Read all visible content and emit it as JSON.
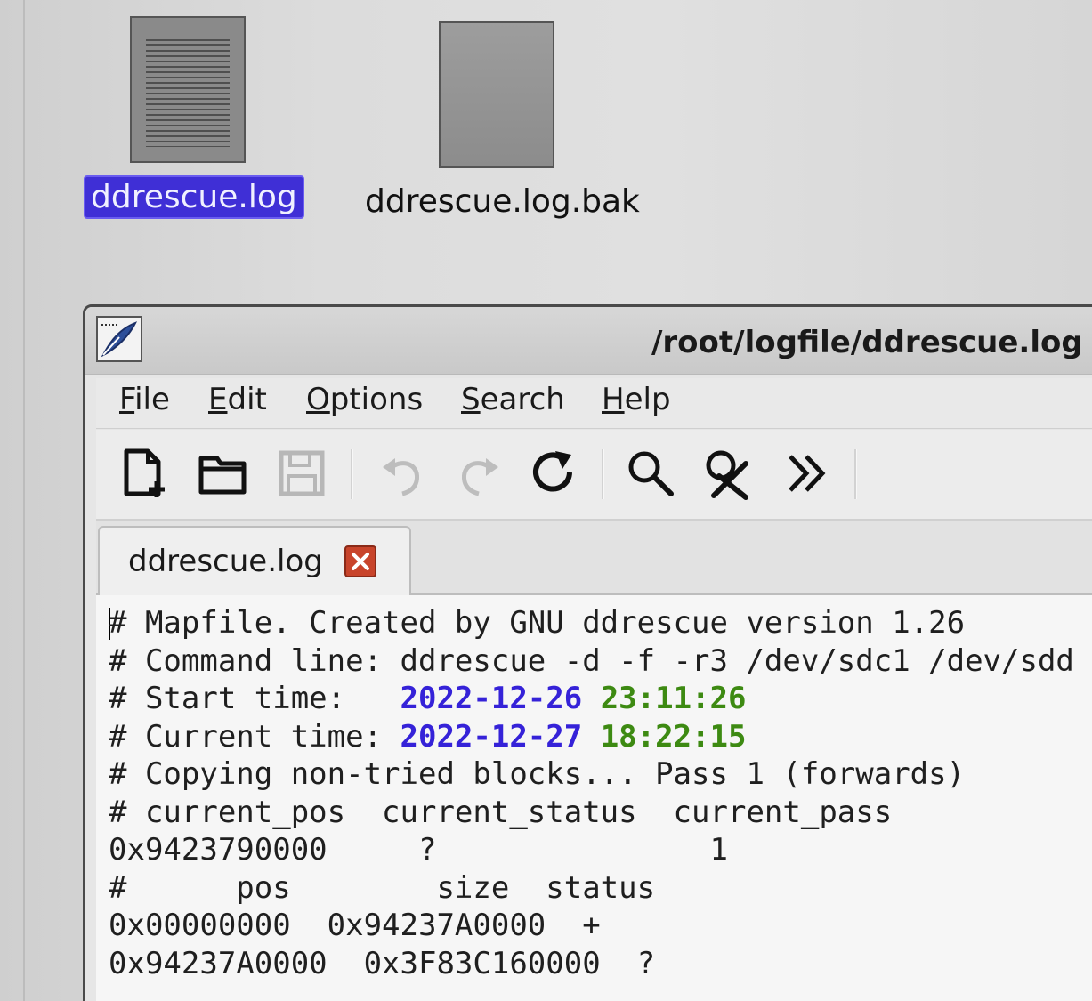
{
  "desktop": {
    "files": [
      {
        "name": "ddrescue.log",
        "selected": true,
        "icon": "text-document-icon"
      },
      {
        "name": "ddrescue.log.bak",
        "selected": false,
        "icon": "blank-document-icon"
      }
    ]
  },
  "window": {
    "title": "/root/logfile/ddrescue.log",
    "app_icon": "quill-pen-icon",
    "menu": [
      {
        "label": "File",
        "mnemonic": "F",
        "rest": "ile"
      },
      {
        "label": "Edit",
        "mnemonic": "E",
        "rest": "dit"
      },
      {
        "label": "Options",
        "mnemonic": "O",
        "rest": "ptions"
      },
      {
        "label": "Search",
        "mnemonic": "S",
        "rest": "earch"
      },
      {
        "label": "Help",
        "mnemonic": "H",
        "rest": "elp"
      }
    ],
    "toolbar": {
      "icons": [
        "new-file-icon",
        "open-folder-icon",
        "save-icon",
        "undo-icon",
        "redo-icon",
        "reload-icon",
        "find-icon",
        "find-replace-icon",
        "more-chevron-icon"
      ]
    },
    "tab": {
      "label": "ddrescue.log",
      "close_icon": "close-icon"
    },
    "editor": {
      "lines": [
        {
          "text": "# Mapfile. Created by GNU ddrescue version 1.26"
        },
        {
          "text": "# Command line: ddrescue -d -f -r3 /dev/sdc1 /dev/sdd"
        },
        {
          "prefix": "# Start time:   ",
          "date": "2022-12-26",
          "time": "23:11:26"
        },
        {
          "prefix": "# Current time: ",
          "date": "2022-12-27",
          "time": "18:22:15"
        },
        {
          "text": "# Copying non-tried blocks... Pass 1 (forwards)"
        },
        {
          "text": "# current_pos  current_status  current_pass"
        },
        {
          "text": "0x9423790000     ?               1"
        },
        {
          "text": "#      pos        size  status"
        },
        {
          "text": "0x00000000  0x94237A0000  +"
        },
        {
          "text": "0x94237A0000  0x3F83C160000  ?"
        }
      ],
      "colors": {
        "date": "#3522d8",
        "time": "#3d8a12"
      }
    }
  }
}
